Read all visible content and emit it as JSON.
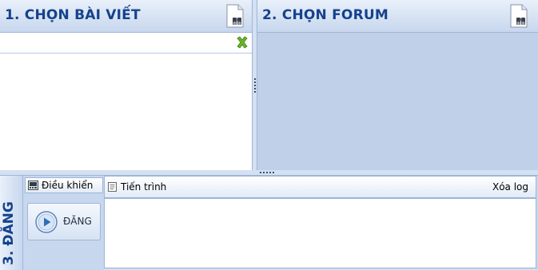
{
  "select_post": {
    "title": "1. CHỌN BÀI VIẾT",
    "header_icon": "document-binoculars-icon",
    "clear_icon": "clear-x-icon"
  },
  "select_forum": {
    "title": "2. CHỌN FORUM",
    "header_icon": "document-binoculars-icon"
  },
  "post_step": {
    "title": "3. ĐĂNG",
    "control_tab": {
      "label": "Điều khiển",
      "icon": "control-panel-icon"
    },
    "post_button": {
      "label": "ĐĂNG",
      "icon": "play-icon"
    },
    "progress_tab": {
      "label": "Tiến trình",
      "icon": "notepad-icon",
      "clear_log": "Xóa log"
    }
  },
  "colors": {
    "title_blue": "#15428b",
    "panel_blue": "#bfd0e8",
    "accent_green": "#6ab42a"
  }
}
